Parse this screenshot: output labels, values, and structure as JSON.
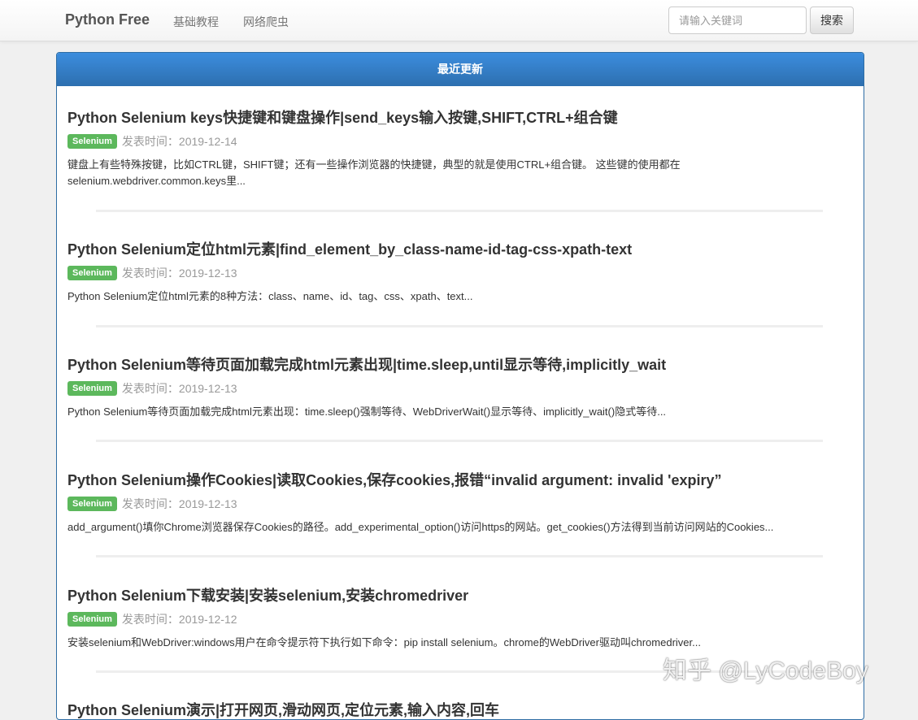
{
  "navbar": {
    "brand": "Python Free",
    "links": [
      "基础教程",
      "网络爬虫"
    ],
    "search_placeholder": "请输入关键词",
    "search_button": "搜索"
  },
  "panel": {
    "heading": "最近更新"
  },
  "posts": [
    {
      "title": "Python Selenium keys快捷键和键盘操作|send_keys输入按键,SHIFT,CTRL+组合键",
      "tag": "Selenium",
      "date": "发表时间：2019-12-14",
      "summary_lines": [
        "键盘上有些特殊按键，比如CTRL键，SHIFT键；还有一些操作浏览器的快捷键，典型的就是使用CTRL+组合键。 这些键的使用都在",
        "selenium.webdriver.common.keys里..."
      ]
    },
    {
      "title": "Python Selenium定位html元素|find_element_by_class-name-id-tag-css-xpath-text",
      "tag": "Selenium",
      "date": "发表时间：2019-12-13",
      "summary_lines": [
        "Python Selenium定位html元素的8种方法：class、name、id、tag、css、xpath、text..."
      ]
    },
    {
      "title": "Python Selenium等待页面加载完成html元素出现|time.sleep,until显示等待,implicitly_wait",
      "tag": "Selenium",
      "date": "发表时间：2019-12-13",
      "summary_lines": [
        "Python Selenium等待页面加载完成html元素出现：time.sleep()强制等待、WebDriverWait()显示等待、implicitly_wait()隐式等待..."
      ]
    },
    {
      "title": "Python Selenium操作Cookies|读取Cookies,保存cookies,报错“invalid argument: invalid 'expiry”",
      "tag": "Selenium",
      "date": "发表时间：2019-12-13",
      "summary_lines": [
        "add_argument()填你Chrome浏览器保存Cookies的路径。add_experimental_option()访问https的网站。get_cookies()方法得到当前访问网站的Cookies..."
      ]
    },
    {
      "title": "Python Selenium下载安装|安装selenium,安装chromedriver",
      "tag": "Selenium",
      "date": "发表时间：2019-12-12",
      "summary_lines": [
        "安装selenium和WebDriver:windows用户在命令提示符下执行如下命令：pip install selenium。chrome的WebDriver驱动叫chromedriver..."
      ]
    },
    {
      "title": "Python Selenium演示|打开网页,滑动网页,定位元素,输入内容,回车",
      "tag": "",
      "date": "",
      "summary_lines": []
    }
  ],
  "watermark": "知乎 @LyCodeBoy"
}
